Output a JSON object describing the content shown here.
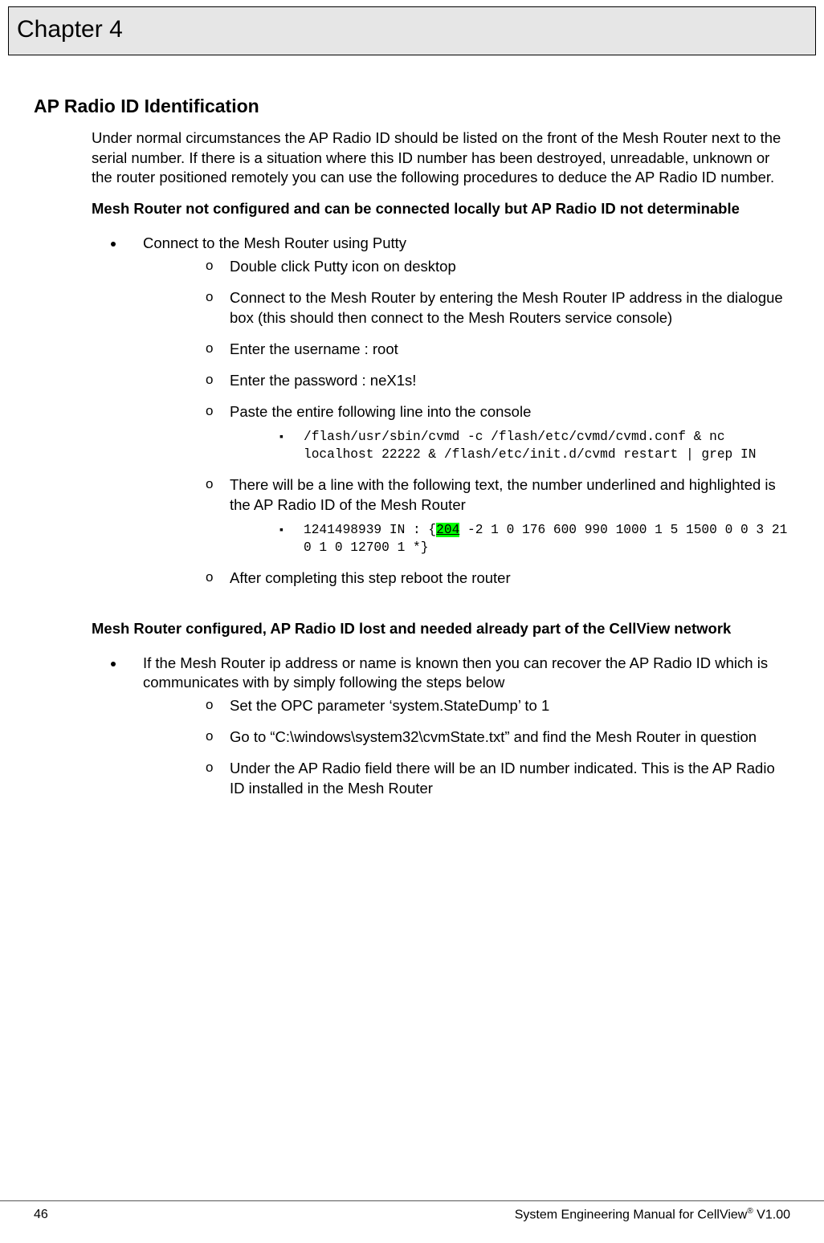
{
  "chapter_label": "Chapter 4",
  "section_title": "AP Radio ID Identification",
  "intro_para": "Under normal circumstances the AP Radio ID should be listed on the front of the Mesh Router next to the serial number. If there is a situation where this ID number has been destroyed, unreadable, unknown or the router positioned remotely you can use the following procedures to deduce the AP Radio ID number.",
  "scenario1_heading": "Mesh Router not configured and can be connected locally but AP Radio ID not determinable",
  "scenario1": {
    "bullet1": "Connect to the Mesh Router using Putty",
    "step1": "Double click Putty icon on desktop",
    "step2": "Connect to the Mesh Router by entering the Mesh Router IP address in the dialogue box  (this should then connect to the Mesh Routers service console)",
    "step3": "Enter the username :  root",
    "step4": "Enter the password :  neX1s!",
    "step5": "Paste the entire following line into the console",
    "code1": "/flash/usr/sbin/cvmd -c /flash/etc/cvmd/cvmd.conf & nc localhost 22222 & /flash/etc/init.d/cvmd restart | grep IN",
    "step6": "There will be a line with the following text, the number underlined and highlighted is the AP Radio ID of the Mesh Router",
    "code2_pre": "1241498939 IN : {",
    "code2_hl": "204",
    "code2_post": " -2 1 0 176 600 990 1000 1 5 1500 0 0 3 21 0 1 0 12700 1 *}",
    "step7": "After completing this step reboot the router"
  },
  "scenario2_heading": "Mesh Router configured, AP Radio ID lost and needed already part of the CellView network",
  "scenario2": {
    "bullet1": "If the Mesh Router ip address or name is known then you can recover the AP Radio ID which is communicates with by simply following the steps below",
    "step1": "Set the OPC parameter ‘system.StateDump’ to 1",
    "step2": "Go to “C:\\windows\\system32\\cvmState.txt” and find the Mesh Router in question",
    "step3": "Under the AP Radio field there will be an ID number indicated. This is the AP Radio ID installed in the Mesh Router"
  },
  "footer": {
    "page_number": "46",
    "doc_title_pre": "System Engineering Manual for CellView",
    "doc_title_post": " V1.00"
  }
}
